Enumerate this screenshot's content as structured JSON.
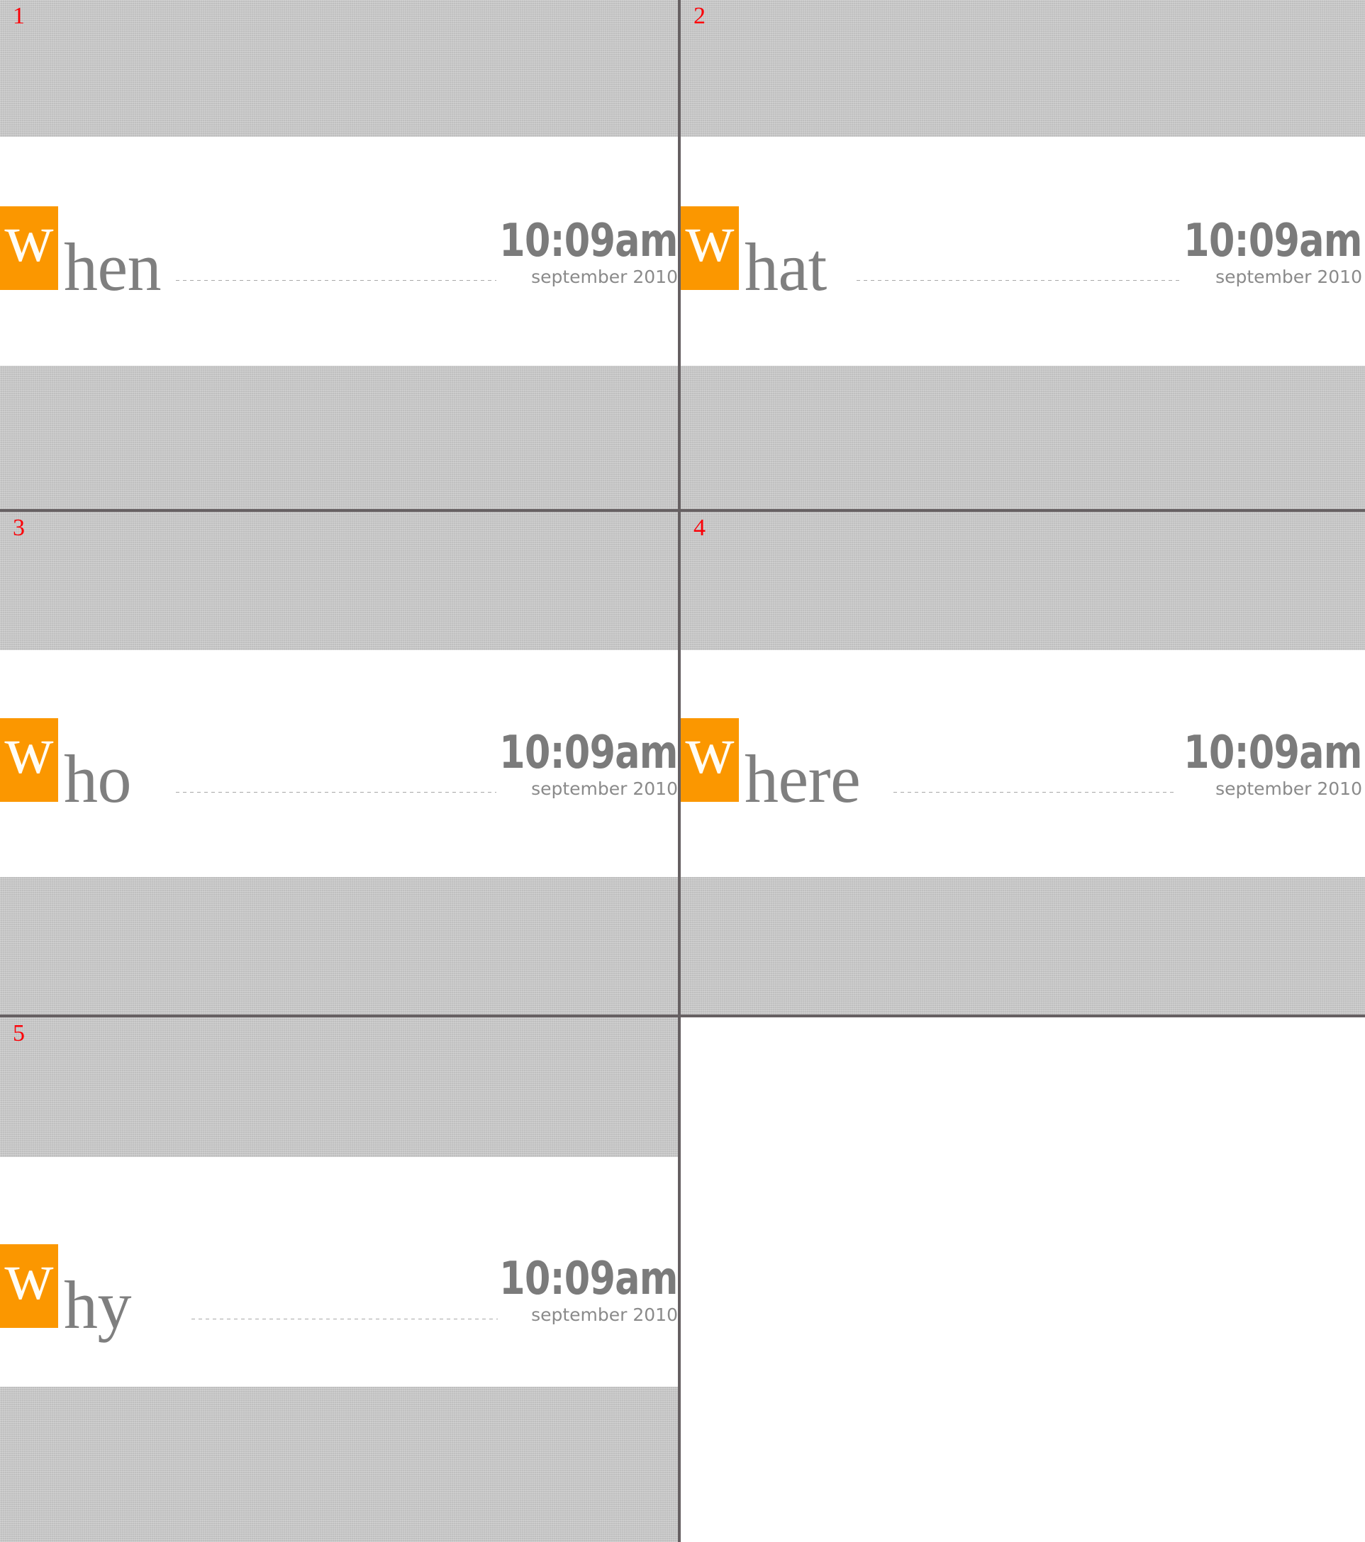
{
  "meta": {
    "description": "Screenshot capture split into numbered tiles",
    "accent_orange": "#fb9700",
    "index_red": "#fb0007",
    "band_gray": "#bfbfbf",
    "word_gray": "#7f7f7f",
    "rule_gray": "#666062"
  },
  "tiles": [
    {
      "index": "1",
      "word_initial": "w",
      "word_rest": "hen",
      "time": "10:09am",
      "date": "september 2010"
    },
    {
      "index": "2",
      "word_initial": "w",
      "word_rest": "hat",
      "time": "10:09am",
      "date": "september 2010"
    },
    {
      "index": "3",
      "word_initial": "w",
      "word_rest": "ho",
      "time": "10:09am",
      "date": "september 2010"
    },
    {
      "index": "4",
      "word_initial": "w",
      "word_rest": "here",
      "time": "10:09am",
      "date": "september 2010"
    },
    {
      "index": "5",
      "word_initial": "w",
      "word_rest": "hy",
      "time": "10:09am",
      "date": "september 2010"
    }
  ]
}
